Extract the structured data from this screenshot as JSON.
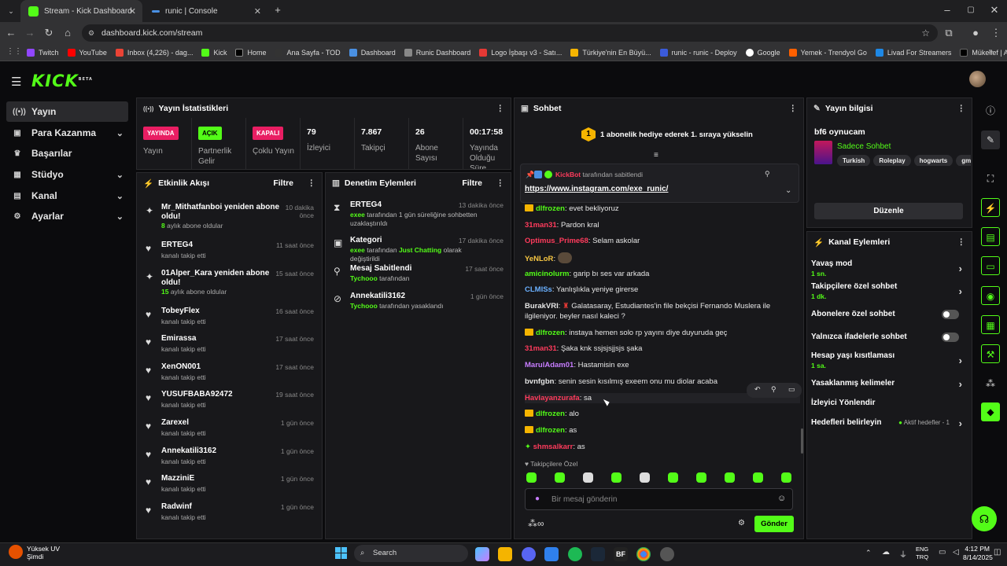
{
  "browser": {
    "tabs": [
      {
        "title": "Stream - Kick Dashboard",
        "active": true
      },
      {
        "title": "runic | Console",
        "active": false
      }
    ],
    "url": "dashboard.kick.com/stream",
    "bookmarks": [
      "Twitch",
      "YouTube",
      "Inbox (4,226) - dag...",
      "Kick",
      "Home",
      "Ana Sayfa - TOD",
      "Dashboard",
      "Runic Dashboard",
      "Logo İşbaşı v3 - Satı...",
      "Türkiye'nin En Büyü...",
      "runic - runic - Deploy",
      "Google",
      "Yemek - Trendyol Go",
      "Livad For Streamers",
      "Mükellef | Anasayfa..."
    ]
  },
  "kick": {
    "logo": "KICK",
    "logo_beta": "BETA"
  },
  "sidebar": {
    "items": [
      {
        "label": "Yayın",
        "icon": "broadcast-icon",
        "active": true
      },
      {
        "label": "Para Kazanma",
        "icon": "money-icon",
        "chevron": true
      },
      {
        "label": "Başarılar",
        "icon": "trophy-icon"
      },
      {
        "label": "Stüdyo",
        "icon": "studio-icon",
        "chevron": true
      },
      {
        "label": "Kanal",
        "icon": "channel-icon",
        "chevron": true
      },
      {
        "label": "Ayarlar",
        "icon": "gear-icon",
        "chevron": true
      }
    ]
  },
  "stats": {
    "title": "Yayın İstatistikleri",
    "items": [
      {
        "badge": "YAYINDA",
        "label": "Yayın",
        "badge_color": "#e91e63"
      },
      {
        "badge": "AÇIK",
        "label": "Partnerlik Gelir",
        "badge_color": "#53fc18"
      },
      {
        "badge": "KAPALI",
        "label": "Çoklu Yayın",
        "badge_color": "#e91e63"
      },
      {
        "value": "79",
        "label": "İzleyici"
      },
      {
        "value": "7.867",
        "label": "Takipçi"
      },
      {
        "value": "26",
        "label": "Abone Sayısı"
      },
      {
        "value": "00:17:58",
        "label": "Yayında Olduğu Süre"
      }
    ]
  },
  "activity": {
    "title": "Etkinlik Akışı",
    "filter": "Filtre",
    "items": [
      {
        "name": "Mr_Mithatfanboi yeniden abone oldu!",
        "count": "8",
        "sub": " aylık abone oldular",
        "time": "10 dakika önce",
        "icon": "sparkle"
      },
      {
        "name": "ERTEG4",
        "sub": "kanalı takip etti",
        "time": "11 saat önce",
        "icon": "heart"
      },
      {
        "name": "01Alper_Kara yeniden abone oldu!",
        "count": "15",
        "sub": " aylık abone oldular",
        "time": "15 saat önce",
        "icon": "sparkle"
      },
      {
        "name": "TobeyFlex",
        "sub": "kanalı takip etti",
        "time": "16 saat önce",
        "icon": "heart"
      },
      {
        "name": "Emirassa",
        "sub": "kanalı takip etti",
        "time": "17 saat önce",
        "icon": "heart"
      },
      {
        "name": "XenON001",
        "sub": "kanalı takip etti",
        "time": "17 saat önce",
        "icon": "heart"
      },
      {
        "name": "YUSUFBABA92472",
        "sub": "kanalı takip etti",
        "time": "19 saat önce",
        "icon": "heart"
      },
      {
        "name": "Zarexel",
        "sub": "kanalı takip etti",
        "time": "1 gün önce",
        "icon": "heart"
      },
      {
        "name": "Annekatili3162",
        "sub": "kanalı takip etti",
        "time": "1 gün önce",
        "icon": "heart"
      },
      {
        "name": "MazziniE",
        "sub": "kanalı takip etti",
        "time": "1 gün önce",
        "icon": "heart"
      },
      {
        "name": "Radwinf",
        "sub": "kanalı takip etti",
        "time": "1 gün önce",
        "icon": "heart"
      }
    ]
  },
  "moderation": {
    "title": "Denetim Eylemleri",
    "filter": "Filtre",
    "items": [
      {
        "name": "ERTEG4",
        "actor": "exee",
        "rest": " tarafından 1 gün süreliğine sohbetten uzaklaştırıldı",
        "time": "13 dakika önce",
        "icon": "hourglass"
      },
      {
        "name": "Kategori",
        "actor": "exee",
        "rest": " tarafından ",
        "highlight": "Just Chatting",
        "rest2": " olarak değiştirildi",
        "time": "17 dakika önce",
        "icon": "category"
      },
      {
        "name": "Mesaj Sabitlendi",
        "actor": "Tychooo",
        "rest": " tarafından",
        "time": "17 saat önce",
        "icon": "pin"
      },
      {
        "name": "Annekatili3162",
        "actor": "Tychooo",
        "rest": " tarafından yasaklandı",
        "time": "1 gün önce",
        "icon": "ban"
      }
    ]
  },
  "chat": {
    "title": "Sohbet",
    "gift_text": "1 abonelik hediye ederek 1. sıraya yükselin",
    "gift_rank": "1",
    "pinned": {
      "by": "KickBot",
      "by_rest": " tarafından sabitlendi",
      "link": "https://www.instagram.com/exe_runic/"
    },
    "messages": [
      {
        "user": "dlfrozen",
        "color": "#53fc18",
        "text": "evet bekliyoruz",
        "badge": true
      },
      {
        "user": "31man31",
        "color": "#ff3b5c",
        "text": "Pardon kral"
      },
      {
        "user": "Optimus_Prime68",
        "color": "#ff3b5c",
        "text": "Selam askolar"
      },
      {
        "user": "YeNLoR",
        "color": "#f5c542",
        "text": "",
        "emote": true
      },
      {
        "user": "amicinolurm",
        "color": "#53fc18",
        "text": "garip bı ses var arkada"
      },
      {
        "user": "CLMISs",
        "color": "#6ab0ff",
        "text": "Yanlışlıkla yeniye girerse"
      },
      {
        "user": "BurakVRI",
        "color": "#e6e6e6",
        "text": "Galatasaray, Estudiantes'in file bekçisi Fernando Muslera ile ilgileniyor. beyler nasıl kaleci ?"
      },
      {
        "user": "dlfrozen",
        "color": "#53fc18",
        "text": "instaya hemen solo rp yayını diye duyuruda geç",
        "badge": true
      },
      {
        "user": "31man31",
        "color": "#ff3b5c",
        "text": "Şaka knk ssjsjsjjsjs şaka"
      },
      {
        "user": "MarulAdam01",
        "color": "#c77dff",
        "text": "Hastamisin exe"
      },
      {
        "user": "bvnfgbn",
        "color": "#e6e6e6",
        "text": "senin sesin kısılmış exeem onu mu diolar acaba"
      },
      {
        "user": "Havlayanzurafa",
        "color": "#ff3b5c",
        "text": "sa"
      },
      {
        "user": "dlfrozen",
        "color": "#53fc18",
        "text": "alo",
        "badge": true
      },
      {
        "user": "dlfrozen",
        "color": "#53fc18",
        "text": "as",
        "badge": true
      },
      {
        "user": "shmsalkarr",
        "color": "#ff3b5c",
        "text": "as",
        "star": true
      }
    ],
    "followers_only": "Takipçilere Özel",
    "input_placeholder": "Bir mesaj gönderin",
    "send": "Gönder"
  },
  "stream_info": {
    "title": "Yayın bilgisi",
    "stream_title": "bf6 oynucam",
    "category": "Sadece Sohbet",
    "tags": [
      "Turkish",
      "Roleplay",
      "hogwarts",
      "gm"
    ],
    "edit": "Düzenle"
  },
  "channel_actions": {
    "title": "Kanal Eylemleri",
    "items": [
      {
        "label": "Yavaş mod",
        "value": "1 sn.",
        "type": "chevron"
      },
      {
        "label": "Takipçilere özel sohbet",
        "value": "1 dk.",
        "type": "chevron"
      },
      {
        "label": "Abonelere özel sohbet",
        "type": "toggle"
      },
      {
        "label": "Yalnızca ifadelerle sohbet",
        "type": "toggle"
      },
      {
        "label": "Hesap yaşı kısıtlaması",
        "value": "1 sa.",
        "type": "chevron"
      },
      {
        "label": "Yasaklanmış kelimeler",
        "type": "chevron"
      },
      {
        "label": "İzleyici Yönlendir",
        "type": "none"
      },
      {
        "label": "Hedefleri belirleyin",
        "extra": "Aktif hedefler - 1",
        "type": "chevron"
      }
    ]
  },
  "taskbar": {
    "weather_title": "Yüksek UV",
    "weather_sub": "Şimdi",
    "search": "Search",
    "lang": "ENG",
    "lang2": "TRQ",
    "time": "4:12 PM",
    "date": "8/14/2025"
  }
}
